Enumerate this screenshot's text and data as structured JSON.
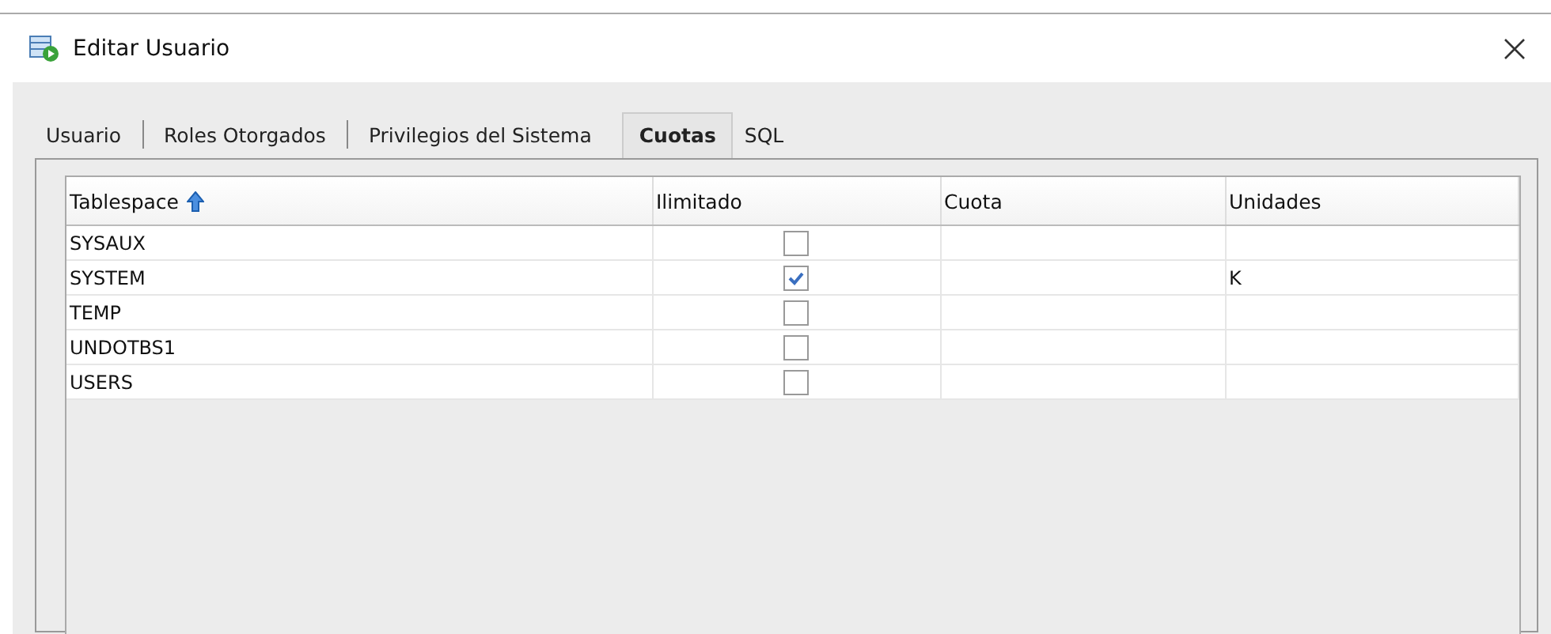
{
  "window": {
    "title": "Editar Usuario"
  },
  "tabs": [
    {
      "label": "Usuario",
      "selected": false
    },
    {
      "label": "Roles Otorgados",
      "selected": false
    },
    {
      "label": "Privilegios del Sistema",
      "selected": false
    },
    {
      "label": "Cuotas",
      "selected": true
    },
    {
      "label": "SQL",
      "selected": false
    }
  ],
  "table": {
    "columns": [
      "Tablespace",
      "Ilimitado",
      "Cuota",
      "Unidades"
    ],
    "rows": [
      {
        "tablespace": "SYSAUX",
        "ilimitado": false
      },
      {
        "tablespace": "SYSTEM",
        "ilimitado": true,
        "unidades": "K"
      },
      {
        "tablespace": "TEMP",
        "ilimitado": false
      },
      {
        "tablespace": "UNDOTBS1",
        "ilimitado": false
      },
      {
        "tablespace": "USERS",
        "ilimitado": false
      }
    ]
  }
}
